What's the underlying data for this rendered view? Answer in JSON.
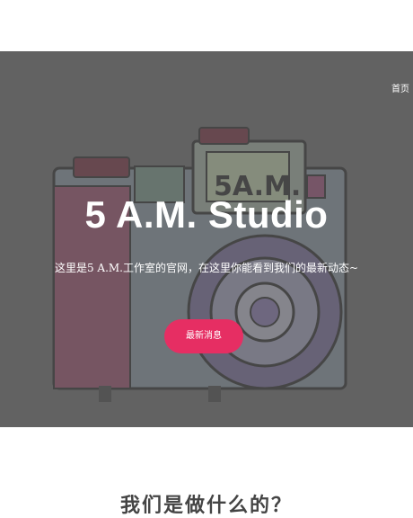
{
  "nav": {
    "home_label": "首页"
  },
  "hero": {
    "title": "5 A.M. Studio",
    "subtitle": "这里是5 A.M.工作室的官网，在这里你能看到我们的最新动态~",
    "button_label": "最新消息",
    "illustration_text": "5A.M.",
    "illustration": "watercolor-camera-illustration"
  },
  "section": {
    "heading": "我们是做什么的？"
  },
  "colors": {
    "hero_bg": "#6a6a6a",
    "button_bg": "#e62e63",
    "heading_text": "#444444"
  }
}
